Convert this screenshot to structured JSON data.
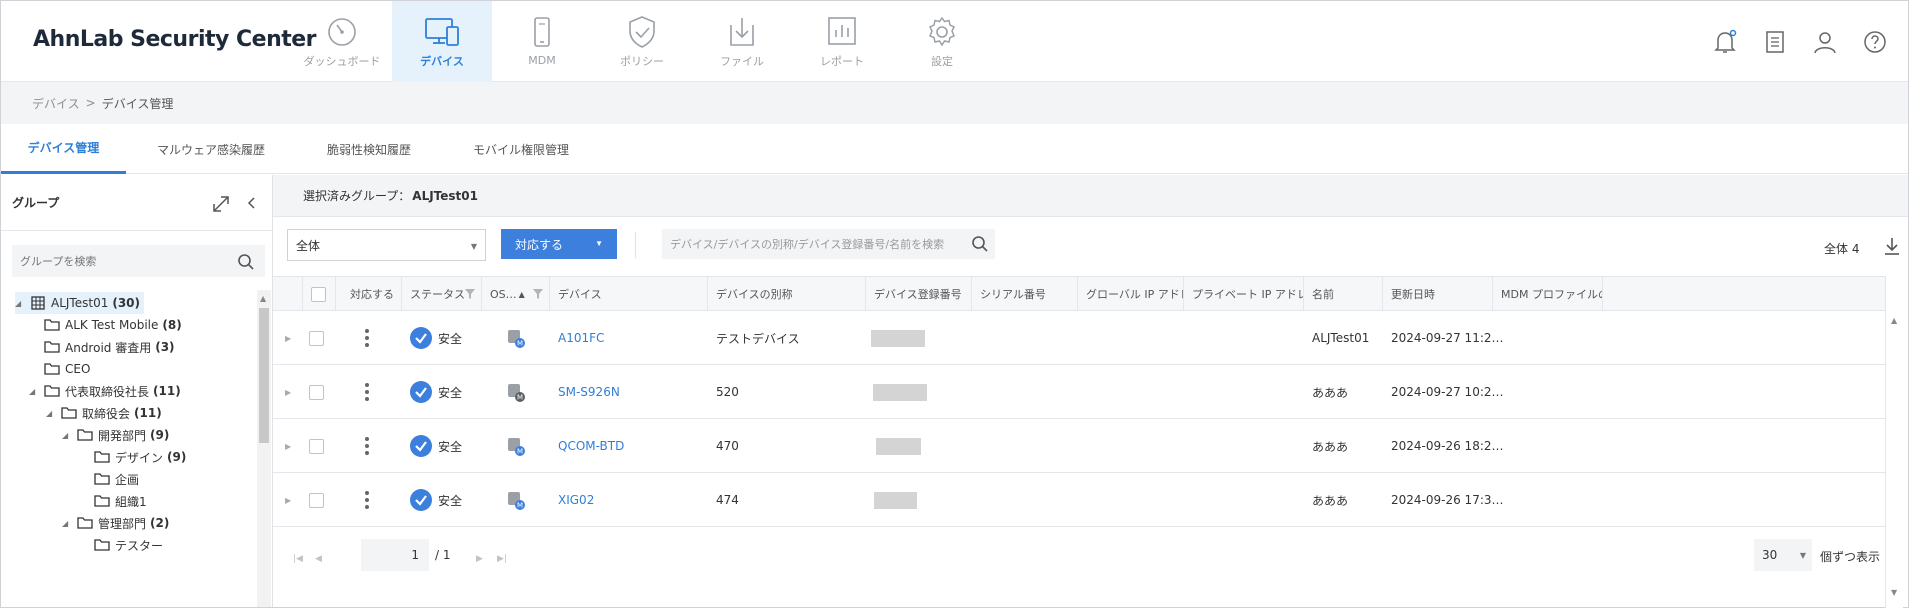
{
  "app": {
    "title": "AhnLab Security Center"
  },
  "nav": [
    {
      "label": "ダッシュボード",
      "icon": "dashboard-gauge-icon",
      "active": false
    },
    {
      "label": "デバイス",
      "icon": "devices-icon",
      "active": true
    },
    {
      "label": "MDM",
      "icon": "mobile-phone-icon",
      "active": false
    },
    {
      "label": "ポリシー",
      "icon": "shield-check-icon",
      "active": false
    },
    {
      "label": "ファイル",
      "icon": "file-download-icon",
      "active": false
    },
    {
      "label": "レポート",
      "icon": "report-chart-icon",
      "active": false
    },
    {
      "label": "設定",
      "icon": "gear-icon",
      "active": false
    }
  ],
  "top_icons": [
    "bell-icon",
    "clipboard-icon",
    "user-icon",
    "help-icon"
  ],
  "breadcrumb": {
    "parent": "デバイス",
    "separator": ">",
    "current": "デバイス管理"
  },
  "subtabs": [
    {
      "label": "デバイス管理",
      "active": true
    },
    {
      "label": "マルウェア感染履歴",
      "active": false
    },
    {
      "label": "脆弱性検知履歴",
      "active": false
    },
    {
      "label": "モバイル権限管理",
      "active": false
    }
  ],
  "group_panel": {
    "title": "グループ",
    "search_placeholder": "グループを検索",
    "tree": [
      {
        "label": "ALJTest01",
        "count": "(30)",
        "type": "org",
        "caret": "◢"
      },
      {
        "label": "ALK Test Mobile",
        "count": "(8)",
        "type": "folder",
        "caret": ""
      },
      {
        "label": "Android 審査用",
        "count": "(3)",
        "type": "folder",
        "caret": ""
      },
      {
        "label": "CEO",
        "count": "",
        "type": "folder",
        "caret": ""
      },
      {
        "label": "代表取締役社長",
        "count": "(11)",
        "type": "folder",
        "caret": "◢"
      },
      {
        "label": "取締役会",
        "count": "(11)",
        "type": "folder",
        "caret": "◢"
      },
      {
        "label": "開発部門",
        "count": "(9)",
        "type": "folder",
        "caret": "◢"
      },
      {
        "label": "デザイン",
        "count": "(9)",
        "type": "folder",
        "caret": ""
      },
      {
        "label": "企画",
        "count": "",
        "type": "folder",
        "caret": ""
      },
      {
        "label": "組織1",
        "count": "",
        "type": "folder",
        "caret": ""
      },
      {
        "label": "管理部門",
        "count": "(2)",
        "type": "folder",
        "caret": "◢"
      },
      {
        "label": "テスター",
        "count": "",
        "type": "folder",
        "caret": ""
      }
    ]
  },
  "selected_group": {
    "prefix": "選択済みグループ：",
    "name": "ALJTest01"
  },
  "toolbar": {
    "filter_value": "全体",
    "action_label": "対応する",
    "search_placeholder": "デバイス/デバイスの別称/デバイス登録番号/名前を検索",
    "total_label": "全体 4"
  },
  "table": {
    "headers": {
      "action": "対応する",
      "status": "ステータス",
      "os": "OS…",
      "device": "デバイス",
      "alias": "デバイスの別称",
      "reg_no": "デバイス登録番号",
      "serial": "シリアル番号",
      "global_ip": "グローバル IP アドレス",
      "private_ip": "プライベート IP アドレス",
      "name": "名前",
      "updated": "更新日時",
      "mdm_profile": "MDM プロファイルの…"
    },
    "rows": [
      {
        "status": "安全",
        "device": "A101FC",
        "alias": "テストデバイス",
        "name": "ALJTest01",
        "updated": "2024-09-27 11:2…"
      },
      {
        "status": "安全",
        "device": "SM-S926N",
        "alias": "520",
        "name": "あああ",
        "updated": "2024-09-27 10:2…"
      },
      {
        "status": "安全",
        "device": "QCOM-BTD",
        "alias": "470",
        "name": "あああ",
        "updated": "2024-09-26 18:2…"
      },
      {
        "status": "安全",
        "device": "XIG02",
        "alias": "474",
        "name": "あああ",
        "updated": "2024-09-26 17:3…"
      }
    ]
  },
  "pagination": {
    "page": "1",
    "of_total": "/ 1",
    "per_page": "30",
    "per_page_label": "個ずつ表示"
  },
  "colors": {
    "accent": "#2f7fd8",
    "button": "#3c7fdc",
    "active_nav_bg": "#e6f2fb"
  }
}
